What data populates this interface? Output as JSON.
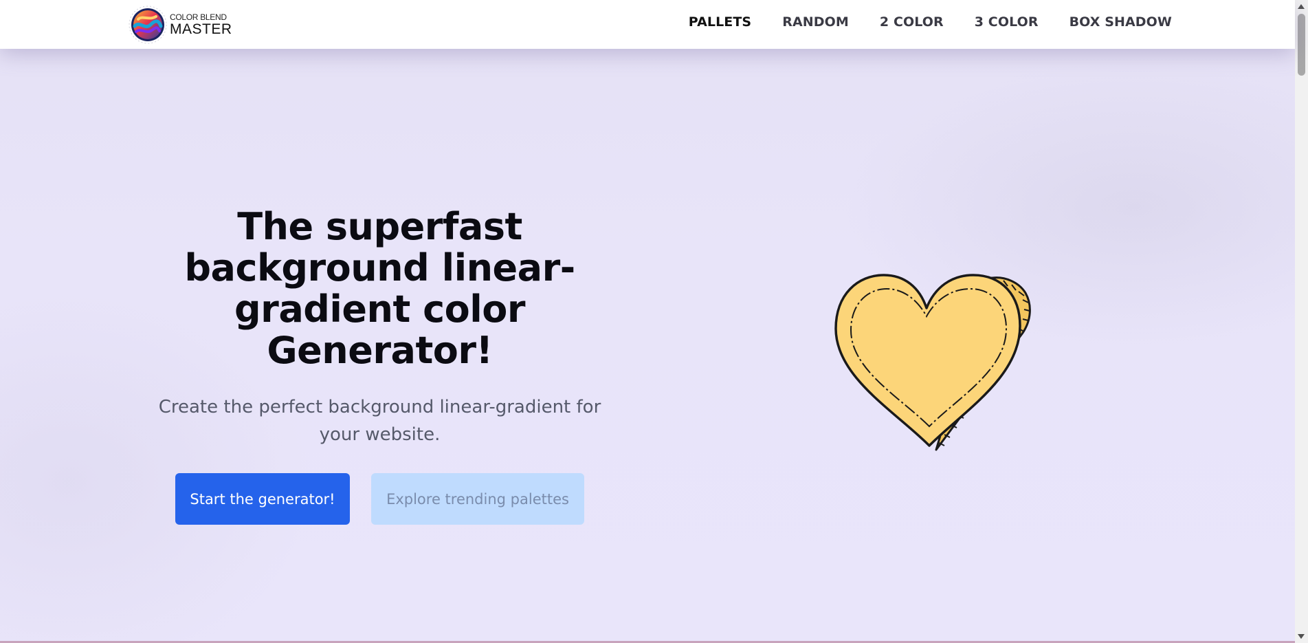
{
  "brand": {
    "line1": "COLOR BLEND",
    "line2": "MASTER"
  },
  "nav": {
    "items": [
      {
        "label": "PALLETS",
        "active": true
      },
      {
        "label": "RANDOM",
        "active": false
      },
      {
        "label": "2 COLOR",
        "active": false
      },
      {
        "label": "3 COLOR",
        "active": false
      },
      {
        "label": "BOX SHADOW",
        "active": false
      }
    ]
  },
  "hero": {
    "title": "The superfast background linear-gradient color Generator!",
    "subtitle": "Create the perfect background linear-gradient for your website.",
    "primary_button": "Start the generator!",
    "secondary_button": "Explore trending palettes"
  },
  "colors": {
    "primary": "#2563eb",
    "secondary": "#bfdbfe",
    "background": "#e7e3f8",
    "heart_fill": "#fcd579"
  },
  "icons": [
    "logo-icon",
    "heart-illustration-icon"
  ]
}
